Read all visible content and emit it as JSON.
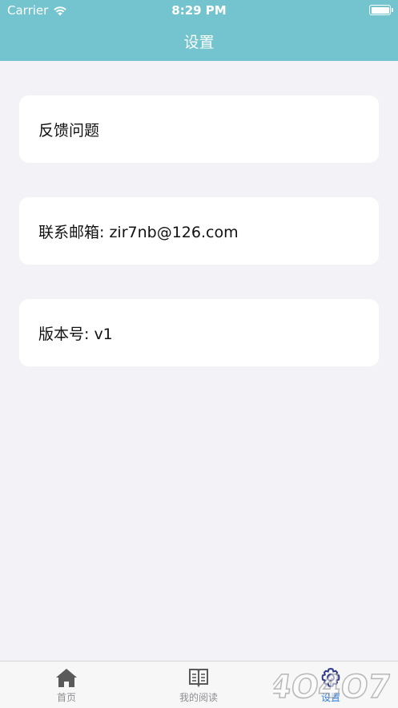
{
  "status_bar": {
    "carrier": "Carrier",
    "time": "8:29 PM"
  },
  "header": {
    "title": "设置",
    "bg_color": "#73c4cf"
  },
  "settings": {
    "items": [
      {
        "label": "反馈问题"
      },
      {
        "label": "联系邮箱: zir7nb@126.com"
      },
      {
        "label": "版本号: v1"
      }
    ]
  },
  "tabbar": {
    "tabs": [
      {
        "label": "首页",
        "icon": "home-icon",
        "active": false
      },
      {
        "label": "我的阅读",
        "icon": "book-icon",
        "active": false
      },
      {
        "label": "设置",
        "icon": "gear-icon",
        "active": true
      }
    ],
    "active_color": "#2f7fe6"
  },
  "watermark": {
    "text": "4O4O7"
  }
}
